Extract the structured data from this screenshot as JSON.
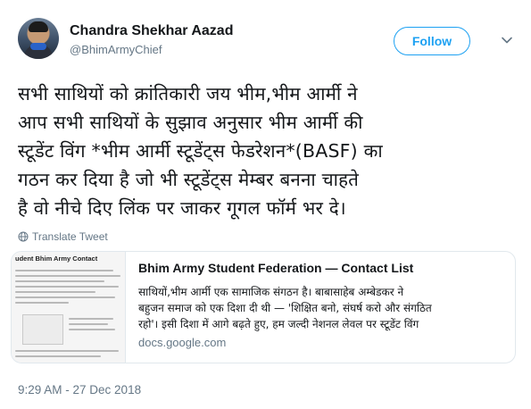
{
  "author": {
    "name": "Chandra Shekhar Aazad",
    "handle": "@BhimArmyChief"
  },
  "follow_label": "Follow",
  "tweet": {
    "lines": [
      "सभी साथियों को क्रांतिकारी जय भीम,भीम आर्मी ने",
      "आप सभी साथियों के सुझाव अनुसार भीम आर्मी की",
      "स्टूडेंट विंग *भीम आर्मी स्टूडेंट्स फेडरेशन*(BASF) का",
      "गठन कर दिया है जो भी स्टूडेंट्स मेम्बर बनना चाहते",
      "है वो नीचे दिए लिंक पर जाकर गूगल फॉर्म भर दे।"
    ]
  },
  "translate_label": "Translate Tweet",
  "card": {
    "thumb_title": "udent Bhim Army Contact",
    "title": "Bhim Army Student Federation — Contact List",
    "desc_lines": [
      "साथियों,भीम आर्मी एक सामाजिक संगठन है। बाबासाहेब अम्बेडकर ने",
      "बहुजन समाज को एक दिशा दी थी — 'शिक्षित बनो, संघर्ष करो और संगठित",
      "रहो'। इसी दिशा में आगे बढ़ते हुए, हम जल्दी नेशनल लेवल पर स्टूडेंट विंग"
    ],
    "domain": "docs.google.com"
  },
  "timestamp": "9:29 AM - 27 Dec 2018",
  "colors": {
    "accent": "#1da1f2",
    "secondary_text": "#657786",
    "border": "#e1e8ed"
  },
  "icons": {
    "caret": "chevron-down-icon",
    "translate": "globe-icon"
  }
}
